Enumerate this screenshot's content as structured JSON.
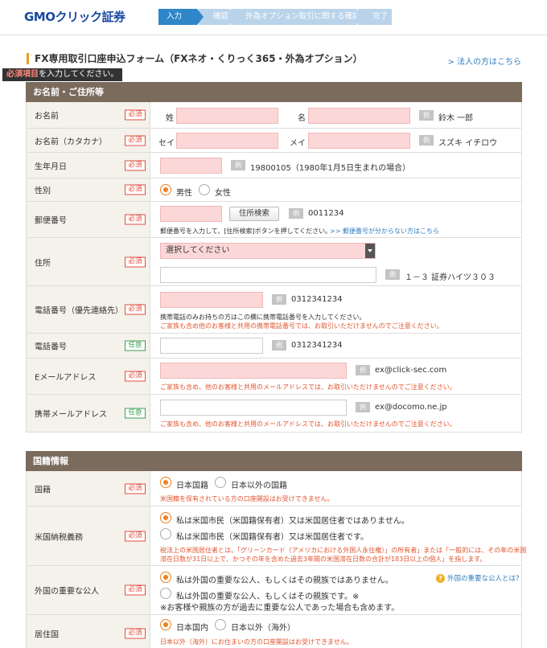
{
  "header": {
    "logo_gmo": "GMO",
    "logo_rest": "クリック証券",
    "steps": [
      "入力",
      "確認",
      "外為オプション取引に関する確認",
      "完了"
    ]
  },
  "page": {
    "title": "FX専用取引口座申込フォーム（FXネオ・くりっく365・外為オプション）",
    "corp_link": "> 法人の方はこちら",
    "req_note_red": "必須項目",
    "req_note_rest": "を入力してください。"
  },
  "badges": {
    "required": "必須",
    "optional": "任意"
  },
  "example_label": "例",
  "section1": {
    "title": "お名前・ご住所等",
    "name": {
      "label": "お名前",
      "sei": "姓",
      "mei": "名",
      "example": "鈴木 一郎"
    },
    "kana": {
      "label": "お名前（カタカナ）",
      "sei": "セイ",
      "mei": "メイ",
      "example": "スズキ イチロウ"
    },
    "birth": {
      "label": "生年月日",
      "example": "19800105（1980年1月5日生まれの場合）"
    },
    "gender": {
      "label": "性別",
      "male": "男性",
      "female": "女性"
    },
    "postal": {
      "label": "郵便番号",
      "button": "住所検索",
      "example": "0011234",
      "note": "郵便番号を入力して、[住所検索]ボタンを押してください。",
      "link": ">> 郵便番号が分からない方はこちら"
    },
    "address": {
      "label": "住所",
      "select": "選択してください",
      "example": "１－３ 証券ハイツ３０３"
    },
    "phone1": {
      "label": "電話番号（優先連絡先）",
      "example": "0312341234",
      "note": "携帯電話のみお持ちの方はこの欄に携帯電話番号を入力してください。",
      "warn": "ご家族も含め他のお客様と共用の携帯電話番号では、お取引いただけませんのでご注意ください。"
    },
    "phone2": {
      "label": "電話番号",
      "example": "0312341234"
    },
    "email": {
      "label": "Eメールアドレス",
      "example": "ex@click-sec.com",
      "warn": "ご家族も含め、他のお客様と共用のメールアドレスでは、お取引いただけませんのでご注意ください。"
    },
    "mobile_email": {
      "label": "携帯メールアドレス",
      "example": "ex@docomo.ne.jp",
      "warn": "ご家族も含め、他のお客様と共用のメールアドレスでは、お取引いただけませんのでご注意ください。"
    }
  },
  "section2": {
    "title": "国籍情報",
    "nationality": {
      "label": "国籍",
      "opt1": "日本国籍",
      "opt2": "日本以外の国籍",
      "warn": "米国籍を保有されている方の口座開設はお受けできません。"
    },
    "us_tax": {
      "label": "米国納税義務",
      "opt1": "私は米国市民（米国籍保有者）又は米国居住者ではありません。",
      "opt2": "私は米国市民（米国籍保有者）又は米国居住者です。",
      "warn1": "税法上の米国居住者とは、「グリーンカード（アメリカにおける外国人永住権）」の所有者」または「一般的には、その年の米国",
      "warn2": "滞在日数が31日以上で、かつその年を含めた過去3年間の米国滞在日数の合計が183日以上の個人」を指します。"
    },
    "pep": {
      "label": "外国の重要な公人",
      "opt1": "私は外国の重要な公人、もしくはその親族ではありません。",
      "opt2": "私は外国の重要な公人、もしくはその親族です。※",
      "note": "※お客様や親族の方が過去に重要な公人であった場合も含めます。",
      "help": "外国の重要な公人とは?"
    },
    "residence": {
      "label": "居住国",
      "opt1": "日本国内",
      "opt2": "日本以外（海外）",
      "warn": "日本以外（海外）にお住まいの方の口座開設はお受けできません。"
    }
  }
}
